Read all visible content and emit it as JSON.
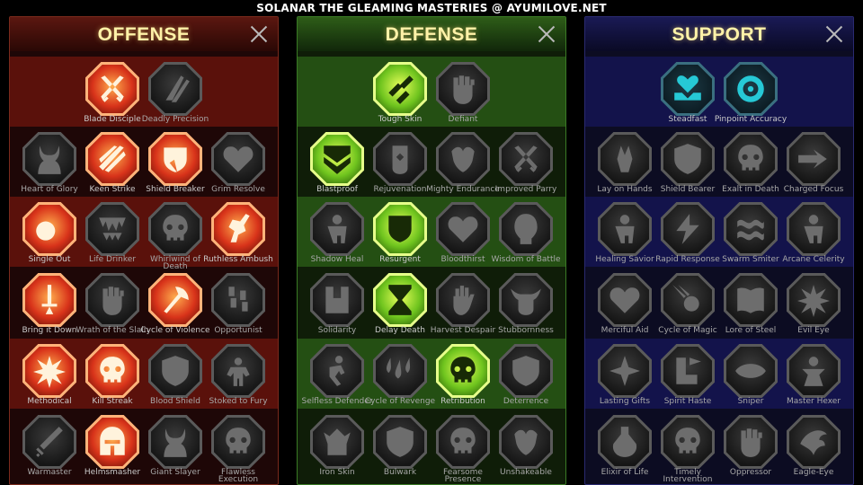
{
  "banner": "SOLANAR THE GLEAMING MASTERIES @ AYUMILOVE.NET",
  "colors": {
    "offense": "#d8331a",
    "defense": "#6fc41e",
    "support": "#26c9d6",
    "title": "#fff2a8"
  },
  "panels": [
    {
      "key": "offense",
      "title": "OFFENSE",
      "rows": [
        [
          {
            "label": "Blade Disciple",
            "active": true,
            "icon": "crossed-swords-icon"
          },
          {
            "label": "Deadly Precision",
            "active": false,
            "icon": "daggers-icon"
          }
        ],
        [
          {
            "label": "Heart of Glory",
            "active": false,
            "icon": "horned-warrior-icon"
          },
          {
            "label": "Keen Strike",
            "active": true,
            "icon": "slash-icon"
          },
          {
            "label": "Shield Breaker",
            "active": true,
            "icon": "broken-shield-icon"
          },
          {
            "label": "Grim Resolve",
            "active": false,
            "icon": "heart-icon"
          }
        ],
        [
          {
            "label": "Single Out",
            "active": true,
            "icon": "arrows-target-icon"
          },
          {
            "label": "Life Drinker",
            "active": false,
            "icon": "fangs-icon"
          },
          {
            "label": "Whirlwind of Death",
            "active": false,
            "icon": "skull-icon"
          },
          {
            "label": "Ruthless Ambush",
            "active": true,
            "icon": "fist-blade-icon"
          }
        ],
        [
          {
            "label": "Bring it Down",
            "active": true,
            "icon": "sword-down-icon"
          },
          {
            "label": "Wrath of the Slain",
            "active": false,
            "icon": "fist-icon"
          },
          {
            "label": "Cycle of Violence",
            "active": true,
            "icon": "axe-icon"
          },
          {
            "label": "Opportunist",
            "active": false,
            "icon": "chains-icon"
          }
        ],
        [
          {
            "label": "Methodical",
            "active": true,
            "icon": "burst-icon"
          },
          {
            "label": "Kill Streak",
            "active": true,
            "icon": "skull-icon"
          },
          {
            "label": "Blood Shield",
            "active": false,
            "icon": "shield-icon"
          },
          {
            "label": "Stoked to Fury",
            "active": false,
            "icon": "fury-icon"
          }
        ],
        [
          {
            "label": "Warmaster",
            "active": false,
            "icon": "sword-icon"
          },
          {
            "label": "Helmsmasher",
            "active": true,
            "icon": "helmet-icon"
          },
          {
            "label": "Giant Slayer",
            "active": false,
            "icon": "horned-warrior-icon"
          },
          {
            "label": "Flawless Execution",
            "active": false,
            "icon": "skull-icon"
          }
        ]
      ]
    },
    {
      "key": "defense",
      "title": "DEFENSE",
      "rows": [
        [
          {
            "label": "Tough Skin",
            "active": true,
            "icon": "scales-icon"
          },
          {
            "label": "Defiant",
            "active": false,
            "icon": "fist-icon"
          }
        ],
        [
          {
            "label": "Blastproof",
            "active": true,
            "icon": "chevron-shield-icon"
          },
          {
            "label": "Rejuvenation",
            "active": false,
            "icon": "hand-heart-icon"
          },
          {
            "label": "Mighty Endurance",
            "active": false,
            "icon": "muscle-icon"
          },
          {
            "label": "Improved Parry",
            "active": false,
            "icon": "crossed-swords-icon"
          }
        ],
        [
          {
            "label": "Shadow Heal",
            "active": false,
            "icon": "figure-icon"
          },
          {
            "label": "Resurgent",
            "active": true,
            "icon": "knight-shield-icon"
          },
          {
            "label": "Bloodthirst",
            "active": false,
            "icon": "heart-skull-icon"
          },
          {
            "label": "Wisdom of Battle",
            "active": false,
            "icon": "head-icon"
          }
        ],
        [
          {
            "label": "Solidarity",
            "active": false,
            "icon": "raised-fists-icon"
          },
          {
            "label": "Delay Death",
            "active": true,
            "icon": "hourglass-icon"
          },
          {
            "label": "Harvest Despair",
            "active": false,
            "icon": "hand-icon"
          },
          {
            "label": "Stubbornness",
            "active": false,
            "icon": "bull-icon"
          }
        ],
        [
          {
            "label": "Selfless Defender",
            "active": false,
            "icon": "runner-icon"
          },
          {
            "label": "Cycle of Revenge",
            "active": false,
            "icon": "drops-icon"
          },
          {
            "label": "Retribution",
            "active": true,
            "icon": "skull-icon"
          },
          {
            "label": "Deterrence",
            "active": false,
            "icon": "shield-icon"
          }
        ],
        [
          {
            "label": "Iron Skin",
            "active": false,
            "icon": "beast-icon"
          },
          {
            "label": "Bulwark",
            "active": false,
            "icon": "shield-icon"
          },
          {
            "label": "Fearsome Presence",
            "active": false,
            "icon": "skull-icon"
          },
          {
            "label": "Unshakeable",
            "active": false,
            "icon": "muscle-icon"
          }
        ]
      ]
    },
    {
      "key": "support",
      "title": "SUPPORT",
      "rows": [
        [
          {
            "label": "Steadfast",
            "active": true,
            "icon": "heart-hands-icon"
          },
          {
            "label": "Pinpoint Accuracy",
            "active": true,
            "icon": "spiral-target-icon"
          }
        ],
        [
          {
            "label": "Lay on Hands",
            "active": false,
            "icon": "praying-hands-icon"
          },
          {
            "label": "Shield Bearer",
            "active": false,
            "icon": "shield-icon"
          },
          {
            "label": "Exalt in Death",
            "active": false,
            "icon": "skull-icon"
          },
          {
            "label": "Charged Focus",
            "active": false,
            "icon": "arrows-icon"
          }
        ],
        [
          {
            "label": "Healing Savior",
            "active": false,
            "icon": "figure-icon"
          },
          {
            "label": "Rapid Response",
            "active": false,
            "icon": "lightning-icon"
          },
          {
            "label": "Swarm Smiter",
            "active": false,
            "icon": "waves-icon"
          },
          {
            "label": "Arcane Celerity",
            "active": false,
            "icon": "figure-icon"
          }
        ],
        [
          {
            "label": "Merciful Aid",
            "active": false,
            "icon": "heart-icon"
          },
          {
            "label": "Cycle of Magic",
            "active": false,
            "icon": "comet-icon"
          },
          {
            "label": "Lore of Steel",
            "active": false,
            "icon": "book-icon"
          },
          {
            "label": "Evil Eye",
            "active": false,
            "icon": "burst-icon"
          }
        ],
        [
          {
            "label": "Lasting Gifts",
            "active": false,
            "icon": "star-icon"
          },
          {
            "label": "Spirit Haste",
            "active": false,
            "icon": "wing-boot-icon"
          },
          {
            "label": "Sniper",
            "active": false,
            "icon": "eye-icon"
          },
          {
            "label": "Master Hexer",
            "active": false,
            "icon": "hexer-icon"
          }
        ],
        [
          {
            "label": "Elixir of Life",
            "active": false,
            "icon": "potion-icon"
          },
          {
            "label": "Timely Intervention",
            "active": false,
            "icon": "skull-icon"
          },
          {
            "label": "Oppressor",
            "active": false,
            "icon": "fist-icon"
          },
          {
            "label": "Eagle-Eye",
            "active": false,
            "icon": "eagle-icon"
          }
        ]
      ]
    }
  ]
}
